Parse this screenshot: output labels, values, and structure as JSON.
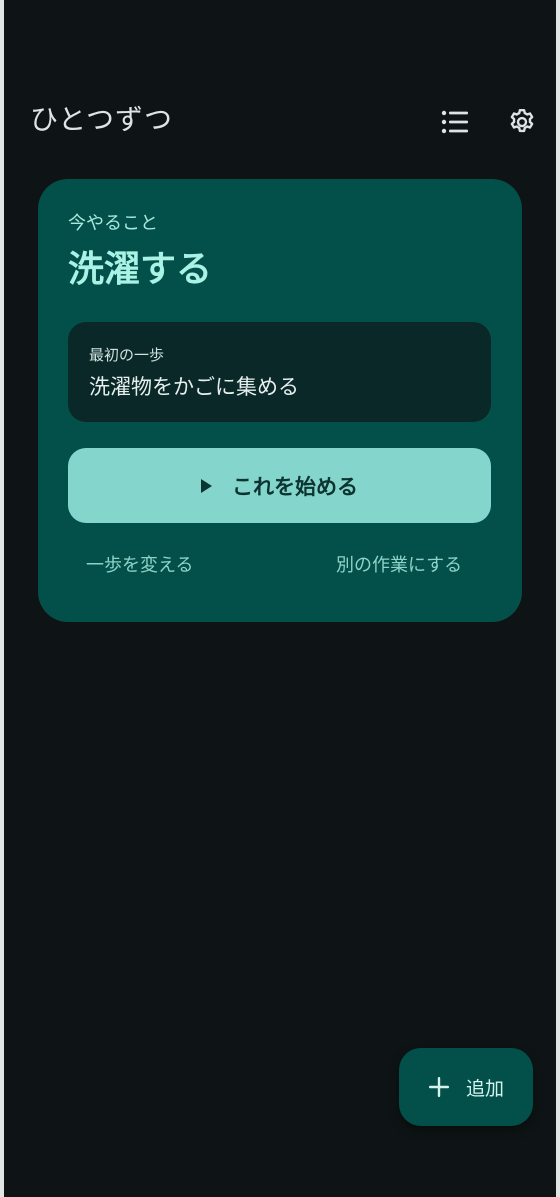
{
  "app": {
    "title": "ひとつずつ"
  },
  "toolbar": {
    "list_icon": "list-icon",
    "settings_icon": "gear-icon"
  },
  "current_task": {
    "eyebrow": "今やること",
    "title": "洗濯する",
    "first_step": {
      "label": "最初の一歩",
      "text": "洗濯物をかごに集める"
    },
    "start_button": {
      "icon": "play-icon",
      "label": "これを始める"
    },
    "change_step_link": "一歩を変える",
    "other_task_link": "別の作業にする"
  },
  "fab": {
    "icon": "plus-icon",
    "label": "追加"
  },
  "colors": {
    "background": "#0e1415",
    "card": "#03504a",
    "step_box": "#0b2828",
    "primary_button": "#84d6cc",
    "accent_text": "#a9f2e5"
  }
}
